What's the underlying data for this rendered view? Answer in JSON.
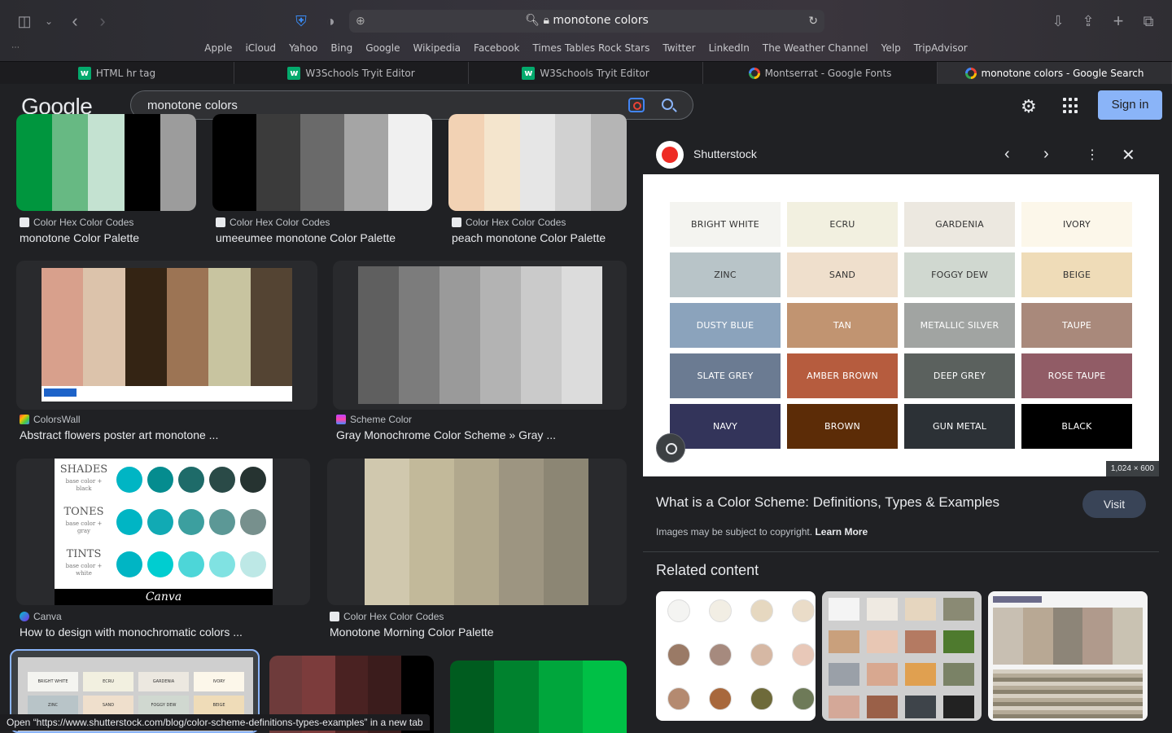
{
  "browser": {
    "url": "monotone colors",
    "bookmarks": [
      "Apple",
      "iCloud",
      "Yahoo",
      "Bing",
      "Google",
      "Wikipedia",
      "Facebook",
      "Times Tables Rock Stars",
      "Twitter",
      "LinkedIn",
      "The Weather Channel",
      "Yelp",
      "TripAdvisor"
    ],
    "tabs": [
      {
        "label": "HTML hr tag",
        "icon": "w3schools-icon"
      },
      {
        "label": "W3Schools Tryit Editor",
        "icon": "w3schools-icon"
      },
      {
        "label": "W3Schools Tryit Editor",
        "icon": "w3schools-icon"
      },
      {
        "label": "Montserrat - Google Fonts",
        "icon": "google-icon"
      },
      {
        "label": "monotone colors - Google Search",
        "icon": "google-icon",
        "active": true
      }
    ]
  },
  "google": {
    "logo": "Google",
    "query": "monotone colors",
    "signin": "Sign in"
  },
  "results": [
    {
      "source": "Color Hex Color Codes",
      "title": "monotone Color Palette",
      "colors": [
        "#00963e",
        "#67b983",
        "#c4e2d1",
        "#000000",
        "#9c9c9c"
      ]
    },
    {
      "source": "Color Hex Color Codes",
      "title": "umeeumee monotone Color Palette",
      "colors": [
        "#000000",
        "#3b3b3b",
        "#6a6a6a",
        "#a5a5a5",
        "#f0f0f0"
      ]
    },
    {
      "source": "Color Hex Color Codes",
      "title": "peach monotone Color Palette",
      "colors": [
        "#f2d2b4",
        "#f4e5cd",
        "#e6e6e6",
        "#d1d1d1",
        "#b5b5b5"
      ]
    },
    {
      "source": "ColorsWall",
      "title": "Abstract flowers poster art monotone ...",
      "colors": [
        "#d8a08c",
        "#dcc3ab",
        "#342414",
        "#9c7454",
        "#c8c4a0",
        "#544433"
      ]
    },
    {
      "source": "Scheme Color",
      "title": "Gray Monochrome Color Scheme » Gray ...",
      "colors": [
        "#5f5f5f",
        "#7c7c7c",
        "#9a9a9a",
        "#b3b3b3",
        "#cacaca",
        "#dcdcdc"
      ]
    },
    {
      "source": "Canva",
      "title": "How to design with monochromatic colors ..."
    },
    {
      "source": "Color Hex Color Codes",
      "title": "Monotone Morning Color Palette",
      "colors": [
        "#d0c8ae",
        "#c2b99a",
        "#b1a88d",
        "#9d9581",
        "#8c8674"
      ]
    }
  ],
  "canva": {
    "rows": [
      {
        "label": "SHADES",
        "sub": "base color + black",
        "colors": [
          "#00b5c4",
          "#058c8f",
          "#1e6b69",
          "#2a4a47",
          "#263331"
        ]
      },
      {
        "label": "TONES",
        "sub": "base color + gray",
        "colors": [
          "#00b5c4",
          "#11aab4",
          "#3c9f9f",
          "#5c9896",
          "#77908d"
        ]
      },
      {
        "label": "TINTS",
        "sub": "base color + white",
        "colors": [
          "#00b5c4",
          "#00cdd0",
          "#4dd6d8",
          "#80e2e2",
          "#bde8e6"
        ]
      }
    ],
    "brand": "Canva"
  },
  "bottom_row": {
    "card1_colors": [
      "#dadada",
      "#dadada"
    ],
    "card2_colors": [
      "#6e3b3b",
      "#7c3c3c",
      "#4a2222",
      "#3b1c1c",
      "#000000"
    ],
    "card3_colors": [
      "#005c1f",
      "#00822e",
      "#00a63c",
      "#00c046"
    ]
  },
  "panel": {
    "site": "Shutterstock",
    "dims": "1,024 × 600",
    "title": "What is a Color Scheme: Definitions, Types & Examples",
    "visit": "Visit",
    "copyright": "Images may be subject to copyright.",
    "learn_more": "Learn More",
    "related": "Related content",
    "swatches": [
      {
        "name": "BRIGHT WHITE",
        "color": "#f4f4f0",
        "text": "#333333"
      },
      {
        "name": "ECRU",
        "color": "#f2f0e0",
        "text": "#333333"
      },
      {
        "name": "GARDENIA",
        "color": "#ece8e0",
        "text": "#333333"
      },
      {
        "name": "IVORY",
        "color": "#fcf7ea",
        "text": "#333333"
      },
      {
        "name": "ZINC",
        "color": "#b8c4c8",
        "text": "#333333"
      },
      {
        "name": "SAND",
        "color": "#efdfcc",
        "text": "#333333"
      },
      {
        "name": "FOGGY DEW",
        "color": "#d0d8d0",
        "text": "#333333"
      },
      {
        "name": "BEIGE",
        "color": "#efdcb8",
        "text": "#333333"
      },
      {
        "name": "DUSTY BLUE",
        "color": "#8ba3bc",
        "text": "#ffffff"
      },
      {
        "name": "TAN",
        "color": "#c19471",
        "text": "#ffffff"
      },
      {
        "name": "METALLIC SILVER",
        "color": "#a1a4a2",
        "text": "#ffffff"
      },
      {
        "name": "TAUPE",
        "color": "#a9897b",
        "text": "#ffffff"
      },
      {
        "name": "SLATE GREY",
        "color": "#6b7b92",
        "text": "#ffffff"
      },
      {
        "name": "AMBER BROWN",
        "color": "#b65c3e",
        "text": "#ffffff"
      },
      {
        "name": "DEEP GREY",
        "color": "#5b615e",
        "text": "#ffffff"
      },
      {
        "name": "ROSE TAUPE",
        "color": "#915c66",
        "text": "#ffffff"
      },
      {
        "name": "NAVY",
        "color": "#33345a",
        "text": "#ffffff"
      },
      {
        "name": "BROWN",
        "color": "#5c2c07",
        "text": "#ffffff"
      },
      {
        "name": "GUN METAL",
        "color": "#2c3136",
        "text": "#ffffff"
      },
      {
        "name": "BLACK",
        "color": "#000000",
        "text": "#ffffff"
      }
    ]
  },
  "status_bar": "Open “https://www.shutterstock.com/blog/color-scheme-definitions-types-examples” in a new tab"
}
